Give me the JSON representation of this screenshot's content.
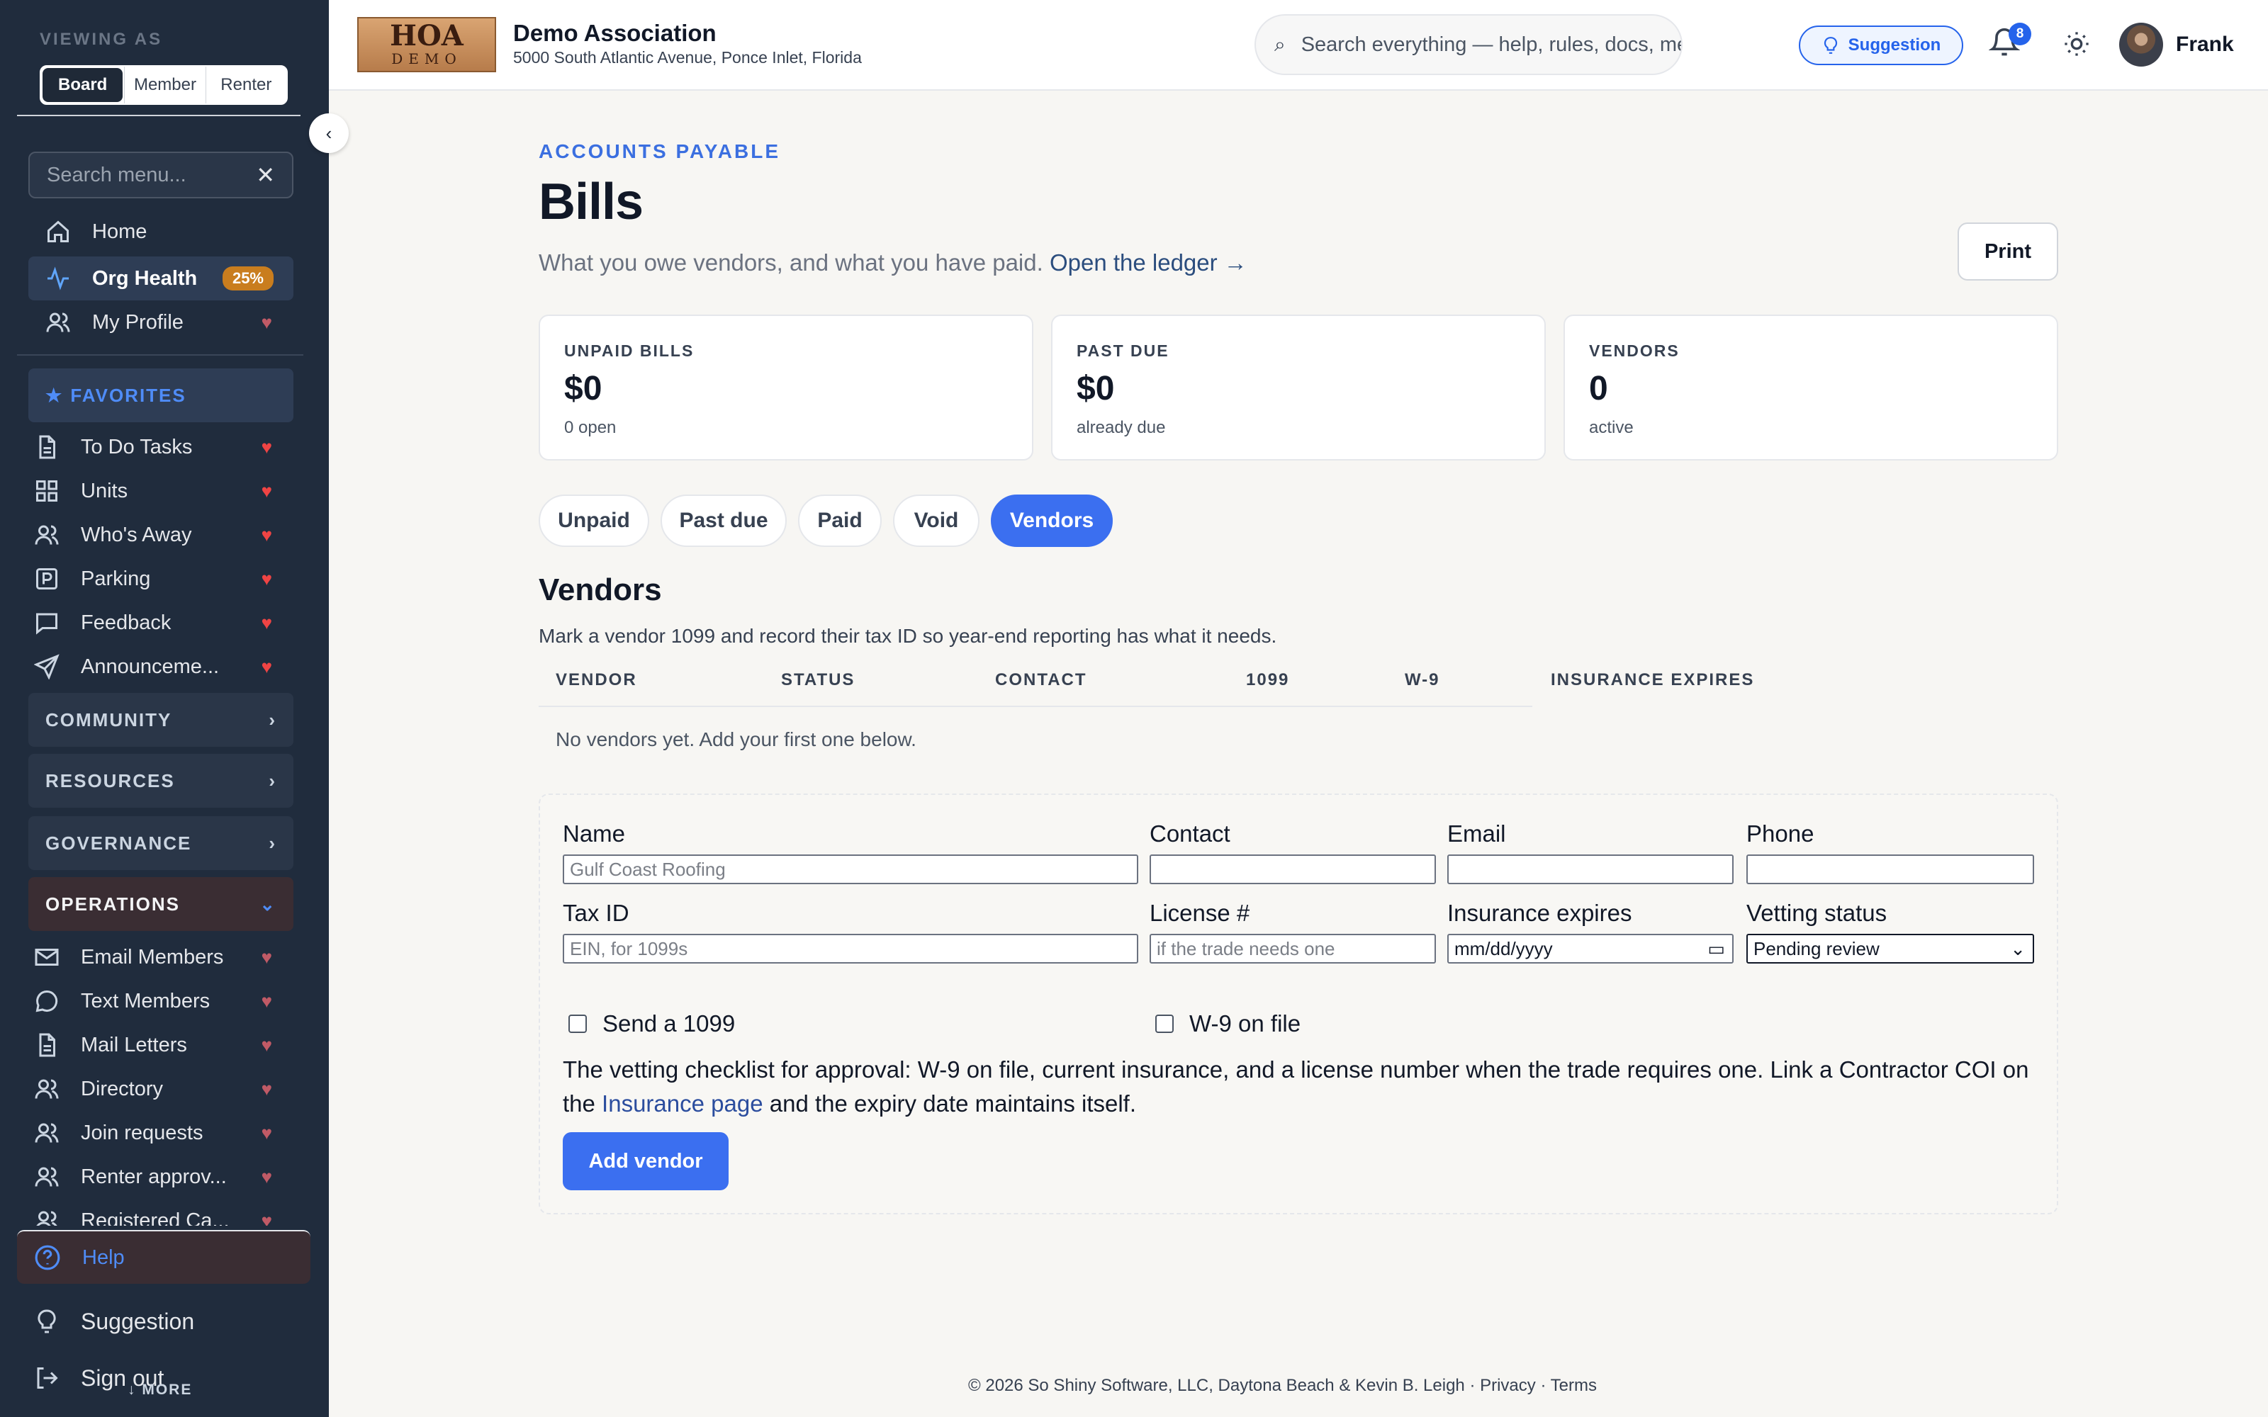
{
  "sidebar": {
    "viewing_as": "VIEWING AS",
    "roles": [
      "Board",
      "Member",
      "Renter"
    ],
    "search_placeholder": "Search menu...",
    "top_items": [
      {
        "label": "Home",
        "icon": "home-icon"
      },
      {
        "label": "Org Health",
        "icon": "activity-icon",
        "badge": "25%"
      },
      {
        "label": "My Profile",
        "icon": "users-icon"
      }
    ],
    "favorites_label": "FAVORITES",
    "favorites": [
      {
        "label": "To Do Tasks",
        "icon": "document-icon"
      },
      {
        "label": "Units",
        "icon": "grid-icon"
      },
      {
        "label": "Who's Away",
        "icon": "users-icon"
      },
      {
        "label": "Parking",
        "icon": "parking-icon"
      },
      {
        "label": "Feedback",
        "icon": "message-icon"
      },
      {
        "label": "Announceme...",
        "icon": "send-icon"
      }
    ],
    "groups": [
      "COMMUNITY",
      "RESOURCES",
      "GOVERNANCE",
      "OPERATIONS"
    ],
    "operations": [
      {
        "label": "Email Members",
        "icon": "mail-icon"
      },
      {
        "label": "Text Members",
        "icon": "chat-icon"
      },
      {
        "label": "Mail Letters",
        "icon": "document-icon"
      },
      {
        "label": "Directory",
        "icon": "users-icon"
      },
      {
        "label": "Join requests",
        "icon": "users-icon"
      },
      {
        "label": "Renter approv...",
        "icon": "users-icon"
      },
      {
        "label": "Registered Ca...",
        "icon": "users-icon"
      }
    ],
    "help_label": "Help",
    "suggestion_label": "Suggestion",
    "signout_label": "Sign out",
    "more_label": "↓ MORE"
  },
  "header": {
    "logo_text_top": "HOA",
    "logo_text_bottom": "DEMO",
    "org_name": "Demo Association",
    "org_address": "5000 South Atlantic Avenue, Ponce Inlet, Florida",
    "search_placeholder": "Search everything — help, rules, docs, mem",
    "suggestion_label": "Suggestion",
    "notification_count": "8",
    "user_name": "Frank"
  },
  "page": {
    "eyebrow": "ACCOUNTS PAYABLE",
    "title": "Bills",
    "subtitle": "What you owe vendors, and what you have paid.",
    "ledger_link": "Open the ledger →",
    "print_label": "Print"
  },
  "stats": [
    {
      "label": "UNPAID BILLS",
      "value": "$0",
      "sub": "0 open"
    },
    {
      "label": "PAST DUE",
      "value": "$0",
      "sub": "already due"
    },
    {
      "label": "VENDORS",
      "value": "0",
      "sub": "active"
    }
  ],
  "tabs": [
    "Unpaid",
    "Past due",
    "Paid",
    "Void",
    "Vendors"
  ],
  "active_tab": "Vendors",
  "vendors": {
    "title": "Vendors",
    "subtitle": "Mark a vendor 1099 and record their tax ID so year-end reporting has what it needs.",
    "columns": [
      "VENDOR",
      "STATUS",
      "CONTACT",
      "1099",
      "W-9",
      "INSURANCE EXPIRES"
    ],
    "empty_text": "No vendors yet. Add your first one below."
  },
  "form": {
    "name_label": "Name",
    "name_placeholder": "Gulf Coast Roofing",
    "contact_label": "Contact",
    "email_label": "Email",
    "phone_label": "Phone",
    "taxid_label": "Tax ID",
    "taxid_placeholder": "EIN, for 1099s",
    "license_label": "License #",
    "license_placeholder": "if the trade needs one",
    "insurance_label": "Insurance expires",
    "insurance_value": "mm/dd/yyyy",
    "vetting_label": "Vetting status",
    "vetting_value": "Pending review",
    "send1099_label": "Send a 1099",
    "w9_label": "W-9 on file",
    "note_before": "The vetting checklist for approval: W-9 on file, current insurance, and a license number when the trade requires one. Link a Contractor COI on the",
    "note_link": "Insurance page",
    "note_after": "and the expiry date maintains itself.",
    "add_label": "Add vendor"
  },
  "footer": {
    "text": "© 2026 So Shiny Software, LLC, Daytona Beach & Kevin B. Leigh · Privacy · Terms"
  },
  "colors": {
    "accent": "#3b6ff0",
    "sidebar_bg": "#202c3d",
    "heart": "#ef4444",
    "badge": "#c97d1e"
  }
}
